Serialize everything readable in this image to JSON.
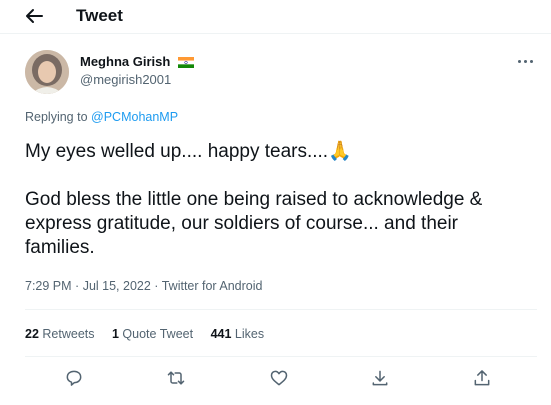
{
  "header": {
    "title": "Tweet",
    "back_icon": "arrow-left-icon"
  },
  "author": {
    "name": "Meghna Girish",
    "handle": "@megirish2001",
    "flag": "india-flag-icon"
  },
  "reply": {
    "prefix": "Replying to",
    "mention": "@PCMohanMP"
  },
  "tweet": {
    "line1": "My eyes welled up.... happy tears....🙏",
    "line2": "God bless the little one being raised to acknowledge & express gratitude, our soldiers of course... and their families."
  },
  "meta": {
    "time": "7:29 PM",
    "date": "Jul 15, 2022",
    "source": "Twitter for Android",
    "sep": "·"
  },
  "stats": {
    "retweets_count": "22",
    "retweets_label": "Retweets",
    "quotes_count": "1",
    "quotes_label": "Quote Tweet",
    "likes_count": "441",
    "likes_label": "Likes"
  },
  "actions": [
    "reply-icon",
    "retweet-icon",
    "like-icon",
    "bookmark-icon",
    "share-icon"
  ],
  "colors": {
    "accent": "#1d9bf0",
    "muted": "#536471",
    "text": "#0f1419",
    "border": "#eff3f4"
  }
}
